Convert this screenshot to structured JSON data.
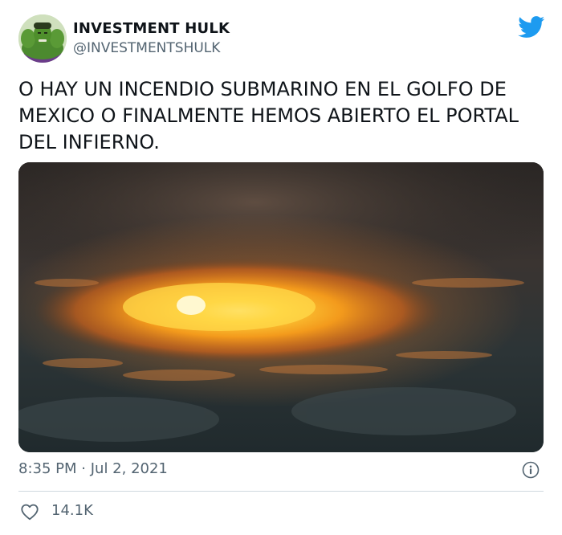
{
  "tweet": {
    "author_name": "INVESTMENT HULK",
    "author_handle": "@INVESTMENTSHULK",
    "text": "O HAY UN INCENDIO SUBMARINO EN EL GOLFO DE MEXICO O FINALMENTE HEMOS ABIERTO EL PORTAL DEL INFIERNO.",
    "time": "8:35 PM",
    "separator": "·",
    "date": "Jul 2, 2021",
    "likes": "14.1K"
  },
  "icons": {
    "brand": "twitter-bird-icon",
    "info": "info-icon",
    "like": "heart-icon"
  },
  "colors": {
    "brand_blue": "#1d9bf0",
    "secondary_text": "#536471",
    "divider": "#cfd9de"
  }
}
